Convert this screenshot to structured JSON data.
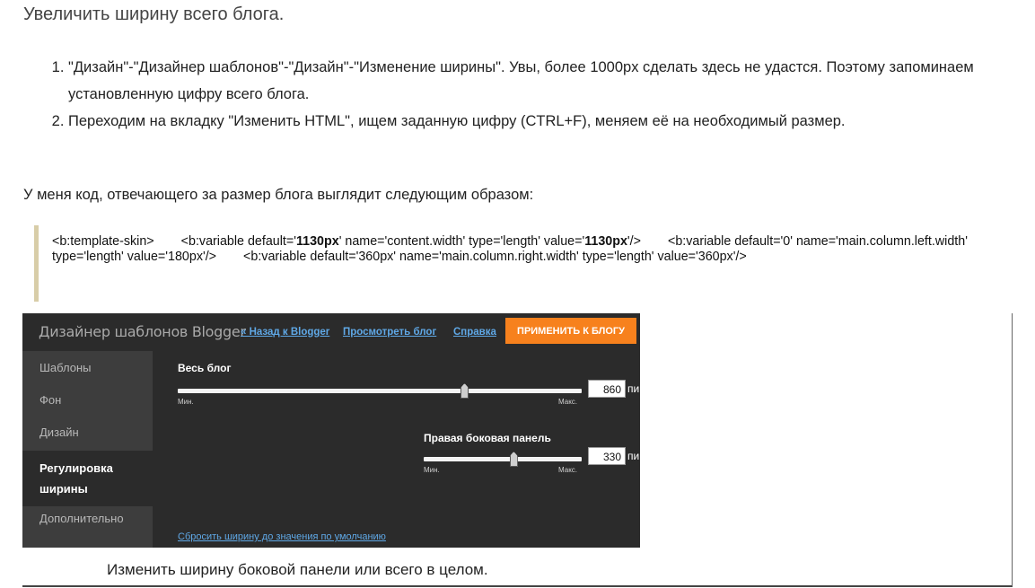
{
  "heading": "Увеличить ширину всего блога.",
  "steps": [
    "\"Дизайн\"-\"Дизайнер шаблонов\"-\"Дизайн\"-\"Изменение ширины\". Увы, более 1000px сделать здесь не удастся. Поэтому запоминаем установленную цифру всего блога.",
    "Переходим на вкладку \"Изменить HTML\", ищем заданную цифру (CTRL+F), меняем её на необходимый размер."
  ],
  "intro": "У меня код, отвечающего за размер блога выглядит следующим образом:",
  "code": {
    "p1": "<b:template-skin>",
    "p2": "<b:variable default='",
    "p2b": "1130px",
    "p3": "' name='content.width' type='length' value='",
    "p3b": "1130px",
    "p4": "'/>",
    "p5": "<b:variable default='0' name='main.column.left.width' type='length' value='180px'/>",
    "p6": "<b:variable default='360px' name='main.column.right.width' type='length' value='360px'/>"
  },
  "designer": {
    "title": "Дизайнер шаблонов Blogger",
    "links": {
      "back": "« Назад к Blogger",
      "view": "Просмотреть блог",
      "help": "Справка"
    },
    "apply": "ПРИМЕНИТЬ К БЛОГУ",
    "sidebar": [
      "Шаблоны",
      "Фон",
      "Дизайн",
      "Регулировка ширины",
      "Дополнительно"
    ],
    "active_index": 3,
    "blog_slider": {
      "label": "Весь блог",
      "min_label": "Мин.",
      "max_label": "Макс.",
      "value": "860",
      "unit": "пи",
      "fraction": 0.71
    },
    "side_slider": {
      "label": "Правая боковая панель",
      "min_label": "Мин.",
      "max_label": "Макс.",
      "value": "330",
      "unit": "пи",
      "fraction": 0.57
    },
    "reset": "Сбросить ширину до значения по умолчанию"
  },
  "caption": "Изменить ширину боковой панели или всего в целом."
}
